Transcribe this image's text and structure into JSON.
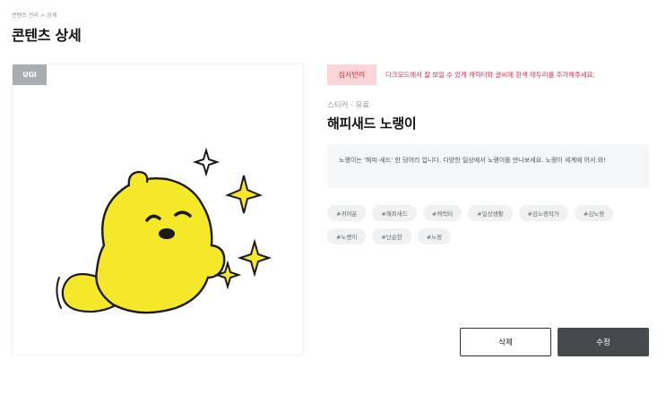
{
  "breadcrumb": "콘텐츠 관리 > 상세",
  "page_title": "콘텐츠 상세",
  "image_badge": "UGI",
  "status": {
    "label": "심사반려",
    "message": "다크모드에서 잘 보일 수 있게 캐릭터와 글씨에 흰색 테두리를 추가해주세요.",
    "colors": {
      "badge_bg": "#fbd5d8",
      "text": "#d6334a"
    }
  },
  "meta": {
    "type": "스티커",
    "separator": "·",
    "price": "유료"
  },
  "sticker_title": "해피새드 노랭이",
  "description": "노랭이는 '해피-새드' 한 덩어리 입니다. 다양한 일상에서 노랭이를 만나보세요. 노랭이 세계에 어서 와!",
  "tags": [
    "#귀여운",
    "#해피새드",
    "#캐릭터",
    "#일상생활",
    "#김노랑작가",
    "#김노랑",
    "#노랭이",
    "#단순한",
    "#노랑"
  ],
  "actions": {
    "delete_label": "삭제",
    "edit_label": "수정"
  },
  "sticker_colors": {
    "body": "#f5e829",
    "outline": "#1a1a1a",
    "sparkle": "#f5e829"
  }
}
